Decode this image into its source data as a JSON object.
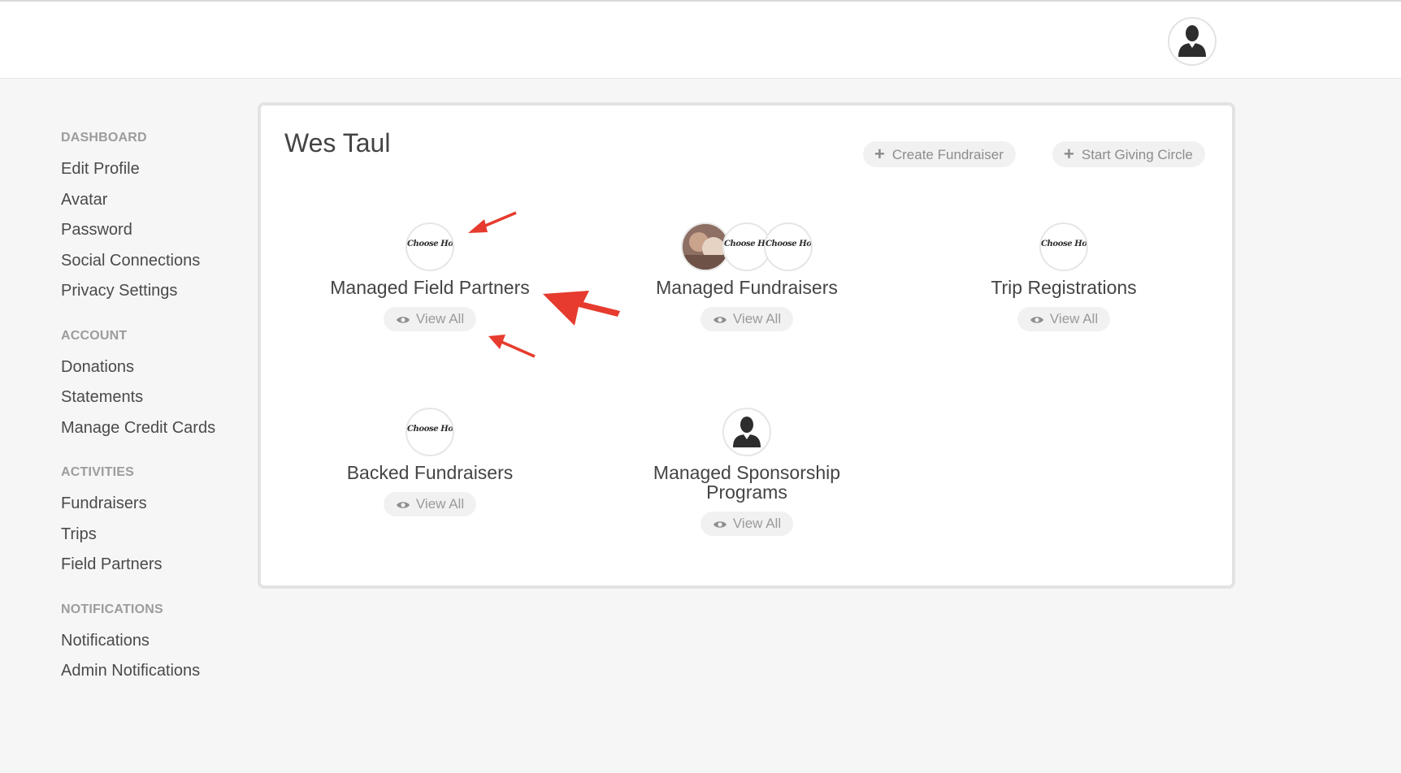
{
  "sidebar": {
    "sections": [
      {
        "heading": "DASHBOARD",
        "items": [
          "Edit Profile",
          "Avatar",
          "Password",
          "Social Connections",
          "Privacy Settings"
        ]
      },
      {
        "heading": "ACCOUNT",
        "items": [
          "Donations",
          "Statements",
          "Manage Credit Cards"
        ]
      },
      {
        "heading": "ACTIVITIES",
        "items": [
          "Fundraisers",
          "Trips",
          "Field Partners"
        ]
      },
      {
        "heading": "NOTIFICATIONS",
        "items": [
          "Notifications",
          "Admin Notifications"
        ]
      }
    ]
  },
  "card": {
    "title": "Wes Taul",
    "create_fundraiser_label": "Create Fundraiser",
    "start_giving_circle_label": "Start Giving Circle",
    "view_all_label": "View All",
    "tiles": [
      {
        "title": "Managed Field Partners",
        "avatars": [
          "Choose Hope"
        ]
      },
      {
        "title": "Managed Fundraisers",
        "avatars": [
          "photo",
          "Choose Hope",
          "Choose Hope"
        ]
      },
      {
        "title": "Trip Registrations",
        "avatars": [
          "Choose Hope"
        ]
      },
      {
        "title": "Backed Fundraisers",
        "avatars": [
          "Choose Hope"
        ]
      },
      {
        "title": "Managed Sponsorship Programs",
        "avatars": [
          "person"
        ]
      }
    ]
  },
  "colors": {
    "annotation_arrow": "#e63b2e",
    "pill_bg": "#f1f1f1",
    "card_border": "#e3e3e3"
  },
  "icons": [
    "user-silhouette-icon",
    "plus-icon",
    "eye-icon",
    "arrow-annotation"
  ]
}
